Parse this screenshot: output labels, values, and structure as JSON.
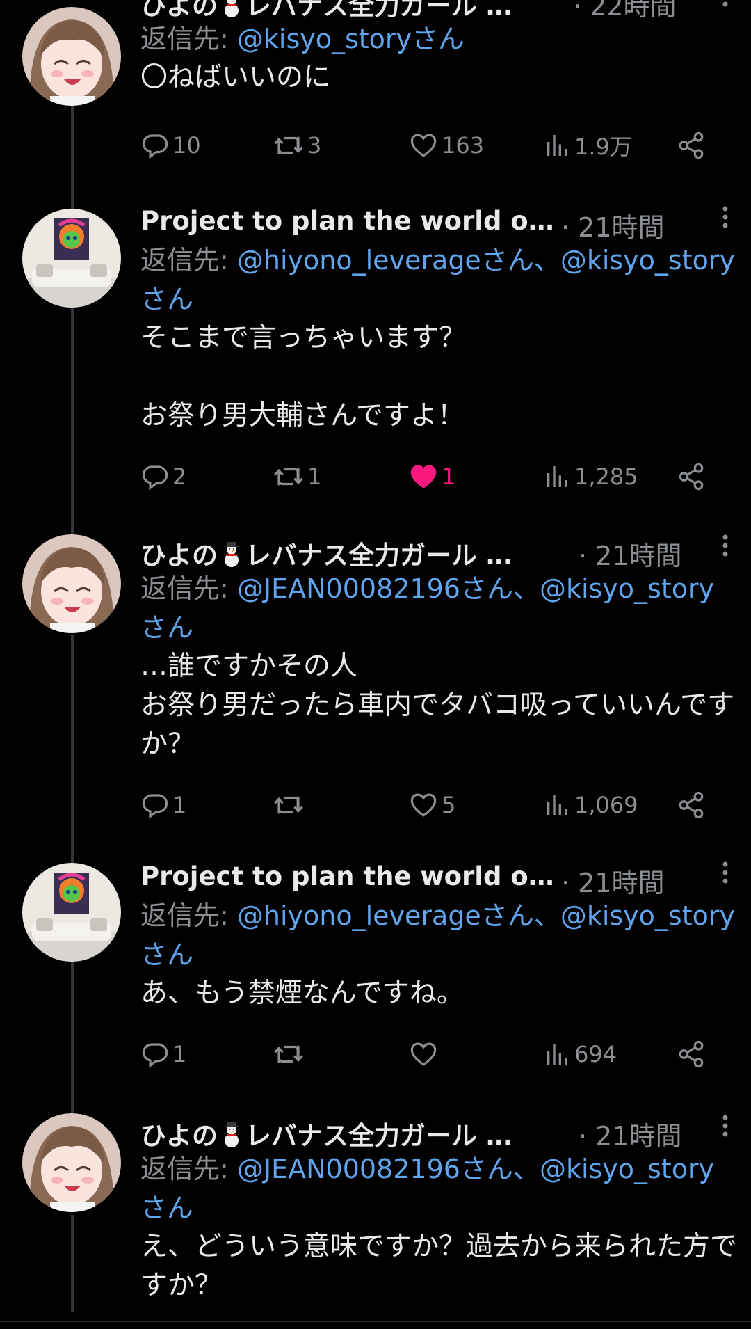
{
  "colors": {
    "background": "#000000",
    "text": "#e7e9ea",
    "secondary": "#8b8f93",
    "link": "#5fa6ef",
    "like_active": "#f91880",
    "thread_line": "#333639"
  },
  "tweets": [
    {
      "author": {
        "name_prefix": "ひよの",
        "name_suffix": "レバナス全力ガール …",
        "has_snowman": true,
        "avatar_icon": "anime-girl-avatar"
      },
      "time": "· 22時間",
      "reply_to_label": "返信先: ",
      "reply_to_handles": "@kisyo_storyさん",
      "text": "〇ねばいいのに",
      "actions": {
        "reply": "10",
        "retweet": "3",
        "like": "163",
        "views": "1.9万",
        "liked": false
      }
    },
    {
      "author": {
        "name_prefix": "Project to plan the world one…",
        "name_suffix": "",
        "has_snowman": false,
        "avatar_icon": "painting-on-sofa-avatar"
      },
      "time": "· 21時間",
      "reply_to_label": "返信先: ",
      "reply_to_handles": "@hiyono_leverageさん、@kisyo_storyさん",
      "text": "そこまで言っちゃいます？\n\nお祭り男大輔さんですよ！",
      "actions": {
        "reply": "2",
        "retweet": "1",
        "like": "1",
        "views": "1,285",
        "liked": true
      }
    },
    {
      "author": {
        "name_prefix": "ひよの",
        "name_suffix": "レバナス全力ガール …",
        "has_snowman": true,
        "avatar_icon": "anime-girl-avatar"
      },
      "time": "· 21時間",
      "reply_to_label": "返信先: ",
      "reply_to_handles": "@JEAN00082196さん、@kisyo_storyさん",
      "text": "…誰ですかその人\nお祭り男だったら車内でタバコ吸っていいんですか？",
      "actions": {
        "reply": "1",
        "retweet": "",
        "like": "5",
        "views": "1,069",
        "liked": false
      }
    },
    {
      "author": {
        "name_prefix": "Project to plan the world one…",
        "name_suffix": "",
        "has_snowman": false,
        "avatar_icon": "painting-on-sofa-avatar"
      },
      "time": "· 21時間",
      "reply_to_label": "返信先: ",
      "reply_to_handles": "@hiyono_leverageさん、@kisyo_storyさん",
      "text": "あ、もう禁煙なんですね。",
      "actions": {
        "reply": "1",
        "retweet": "",
        "like": "",
        "views": "694",
        "liked": false
      }
    },
    {
      "author": {
        "name_prefix": "ひよの",
        "name_suffix": "レバナス全力ガール …",
        "has_snowman": true,
        "avatar_icon": "anime-girl-avatar"
      },
      "time": "· 21時間",
      "reply_to_label": "返信先: ",
      "reply_to_handles": "@JEAN00082196さん、@kisyo_storyさん",
      "text": "え、どういう意味ですか？過去から来られた方ですか？",
      "actions": null
    }
  ]
}
